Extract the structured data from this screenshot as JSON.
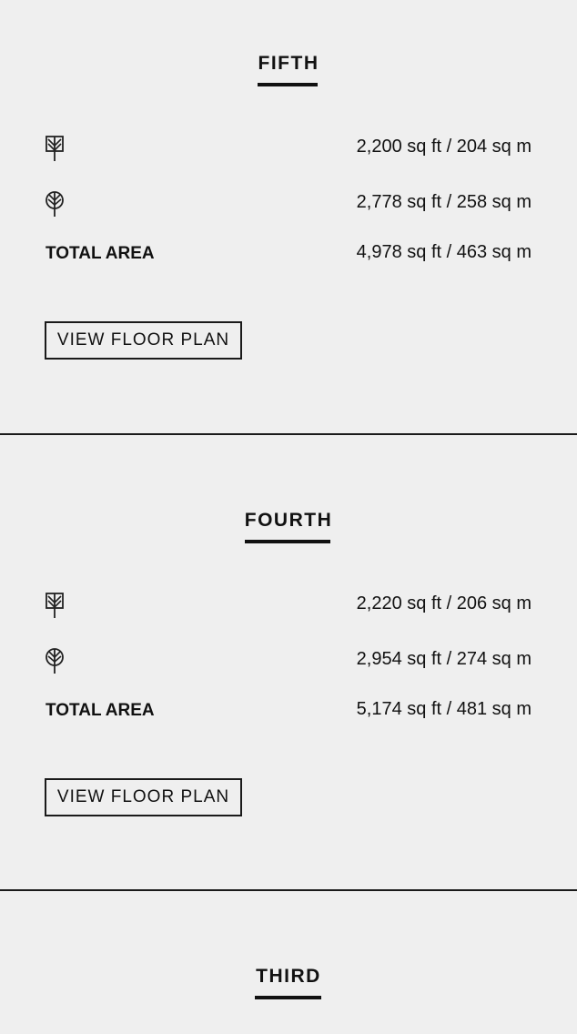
{
  "floors": [
    {
      "title": "FIFTH",
      "interior_area": "2,200 sq ft / 204 sq m",
      "exterior_area": "2,778 sq ft / 258 sq m",
      "total_label": "TOTAL AREA",
      "total_area": "4,978 sq ft / 463 sq m",
      "button_label": "VIEW FLOOR PLAN"
    },
    {
      "title": "FOURTH",
      "interior_area": "2,220 sq ft / 206 sq m",
      "exterior_area": "2,954 sq ft / 274 sq m",
      "total_label": "TOTAL AREA",
      "total_area": "5,174 sq ft / 481 sq m",
      "button_label": "VIEW FLOOR PLAN"
    },
    {
      "title": "THIRD"
    }
  ],
  "icons": {
    "interior": "square-leaf-icon",
    "exterior": "round-leaf-icon"
  }
}
